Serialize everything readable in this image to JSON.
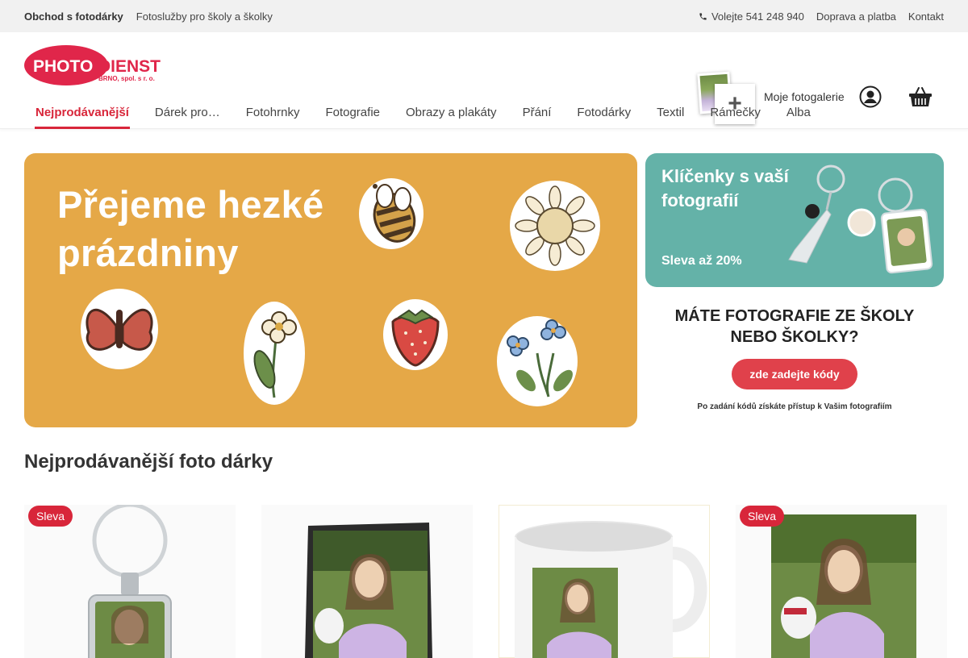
{
  "topbar": {
    "shop": "Obchod s fotodárky",
    "school": "Fotoslužby pro školy a školky",
    "phone": "Volejte 541 248 940",
    "delivery": "Doprava a platba",
    "contact": "Kontakt"
  },
  "header": {
    "logo_photo": "PHOTO",
    "logo_dienst": "DIENST",
    "logo_sub": "BRNO, spol. s r. o.",
    "gallery_label": "Moje fotogalerie"
  },
  "nav": [
    {
      "label": "Nejprodávanější",
      "active": true
    },
    {
      "label": "Dárek pro…"
    },
    {
      "label": "Fotohrnky"
    },
    {
      "label": "Fotografie"
    },
    {
      "label": "Obrazy a plakáty"
    },
    {
      "label": "Přání"
    },
    {
      "label": "Fotodárky"
    },
    {
      "label": "Textil"
    },
    {
      "label": "Rámečky"
    },
    {
      "label": "Alba"
    }
  ],
  "banners": {
    "main_title_line1": "Přejeme hezké",
    "main_title_line2": "prázdniny",
    "keychain_line1": "Klíčenky s vaší",
    "keychain_line2": "fotografií",
    "keychain_discount": "Sleva až 20%",
    "school_line1": "MÁTE FOTOGRAFIE ZE ŠKOLY",
    "school_line2": "NEBO ŠKOLKY?",
    "school_button": "zde zadejte kódy",
    "school_note": "Po zadání kódů získáte přístup k Vašim fotografiím"
  },
  "section": {
    "title": "Nejprodávanější foto dárky"
  },
  "products": [
    {
      "badge": "Sleva",
      "type": "keychain"
    },
    {
      "badge": "",
      "type": "slate"
    },
    {
      "badge": "",
      "type": "mug"
    },
    {
      "badge": "Sleva",
      "type": "canvas"
    }
  ],
  "colors": {
    "brand_red": "#d8263a",
    "banner_orange": "#e5a847",
    "banner_teal": "#64b2a8",
    "topbar_bg": "#f1f1f1"
  }
}
